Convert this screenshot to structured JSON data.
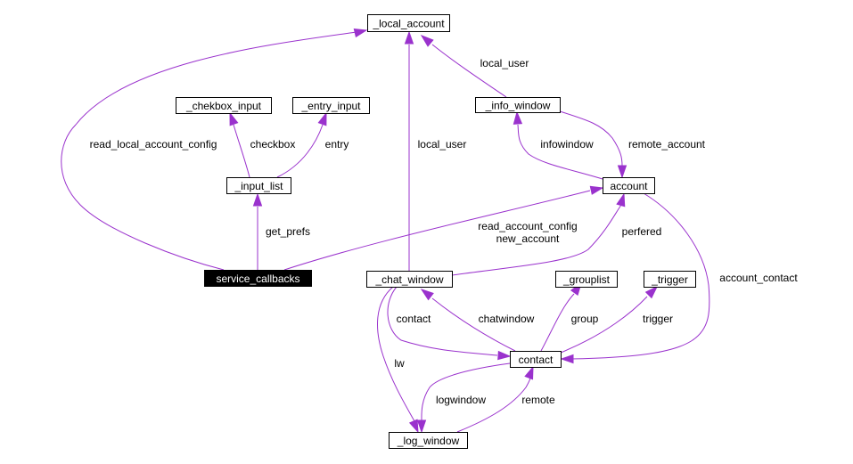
{
  "diagram": {
    "type": "collaboration-graph",
    "edge_color": "#9a32cd",
    "nodes": [
      {
        "id": "local_account",
        "label": "_local_account",
        "highlighted": false
      },
      {
        "id": "chekbox_input",
        "label": "_chekbox_input",
        "highlighted": false
      },
      {
        "id": "entry_input",
        "label": "_entry_input",
        "highlighted": false
      },
      {
        "id": "info_window",
        "label": "_info_window",
        "highlighted": false
      },
      {
        "id": "input_list",
        "label": "_input_list",
        "highlighted": false
      },
      {
        "id": "account",
        "label": "account",
        "highlighted": false
      },
      {
        "id": "service_callbacks",
        "label": "service_callbacks",
        "highlighted": true
      },
      {
        "id": "chat_window",
        "label": "_chat_window",
        "highlighted": false
      },
      {
        "id": "grouplist",
        "label": "_grouplist",
        "highlighted": false
      },
      {
        "id": "trigger",
        "label": "_trigger",
        "highlighted": false
      },
      {
        "id": "contact",
        "label": "contact",
        "highlighted": false
      },
      {
        "id": "log_window",
        "label": "_log_window",
        "highlighted": false
      }
    ],
    "edges": [
      {
        "from": "service_callbacks",
        "to": "local_account",
        "labels": [
          "read_local_account_config"
        ]
      },
      {
        "from": "chat_window",
        "to": "local_account",
        "labels": [
          "local_user"
        ]
      },
      {
        "from": "info_window",
        "to": "local_account",
        "labels": [
          "local_user"
        ]
      },
      {
        "from": "input_list",
        "to": "chekbox_input",
        "labels": [
          "checkbox"
        ]
      },
      {
        "from": "input_list",
        "to": "entry_input",
        "labels": [
          "entry"
        ]
      },
      {
        "from": "service_callbacks",
        "to": "input_list",
        "labels": [
          "get_prefs"
        ]
      },
      {
        "from": "account",
        "to": "info_window",
        "labels": [
          "infowindow"
        ]
      },
      {
        "from": "info_window",
        "to": "account",
        "labels": [
          "remote_account"
        ]
      },
      {
        "from": "service_callbacks",
        "to": "account",
        "labels": [
          "read_account_config",
          "new_account"
        ]
      },
      {
        "from": "chat_window",
        "to": "account",
        "labels": [
          "perfered"
        ]
      },
      {
        "from": "account",
        "to": "contact",
        "labels": [
          "account_contact"
        ]
      },
      {
        "from": "chat_window",
        "to": "contact",
        "labels": [
          "contact"
        ]
      },
      {
        "from": "contact",
        "to": "chat_window",
        "labels": [
          "chatwindow"
        ]
      },
      {
        "from": "contact",
        "to": "grouplist",
        "labels": [
          "group"
        ]
      },
      {
        "from": "contact",
        "to": "trigger",
        "labels": [
          "trigger"
        ]
      },
      {
        "from": "chat_window",
        "to": "log_window",
        "labels": [
          "lw"
        ]
      },
      {
        "from": "contact",
        "to": "log_window",
        "labels": [
          "logwindow"
        ]
      },
      {
        "from": "log_window",
        "to": "contact",
        "labels": [
          "remote"
        ]
      }
    ]
  }
}
